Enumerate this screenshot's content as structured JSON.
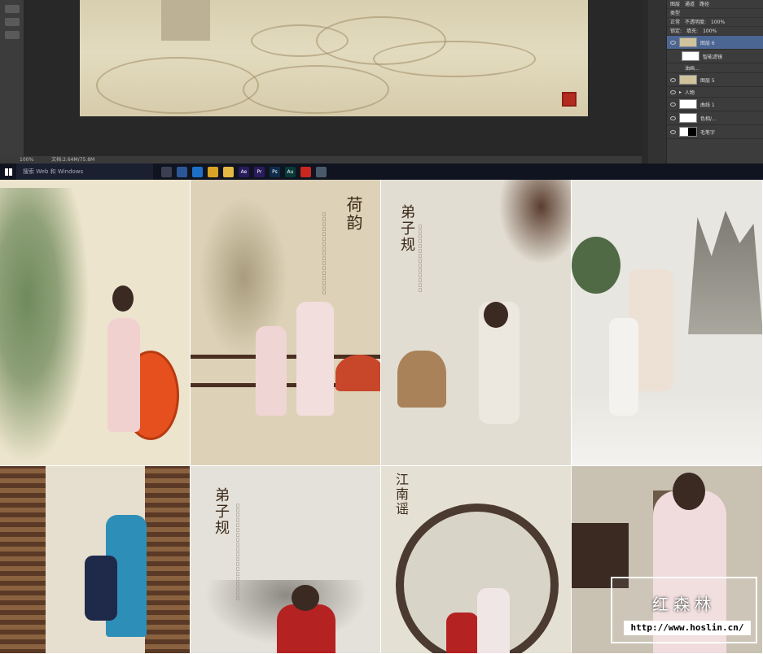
{
  "photoshop": {
    "status_zoom": "100%",
    "status_doc": "文档:2.64M/75.8M",
    "layers_panel": {
      "header_tabs": [
        "图层",
        "通道",
        "路径"
      ],
      "filter_kind": "类型",
      "blend_mode": "正常",
      "opacity_label": "不透明度:",
      "opacity_value": "100%",
      "lock_label": "锁定:",
      "fill_label": "填充:",
      "fill_value": "100%",
      "layers": [
        {
          "name": "图层 6",
          "selected": true
        },
        {
          "name": "智能滤镜",
          "selected": false
        },
        {
          "name": "油画...",
          "selected": false
        },
        {
          "name": "图层 5",
          "selected": false
        },
        {
          "name": "人物",
          "selected": false
        },
        {
          "name": "曲线 1",
          "selected": false
        },
        {
          "name": "色相/...",
          "selected": false
        },
        {
          "name": "毛笔字",
          "selected": false
        }
      ]
    }
  },
  "taskbar": {
    "search_placeholder": "搜索 Web 和 Windows",
    "apps": [
      {
        "icon": "task-view-icon",
        "color": "#3a4052"
      },
      {
        "icon": "store-icon",
        "color": "#2b5797"
      },
      {
        "icon": "edge-icon",
        "color": "#1e6fc8"
      },
      {
        "icon": "chrome-icon",
        "color": "#d9a327"
      },
      {
        "icon": "explorer-icon",
        "color": "#e3b844"
      },
      {
        "icon": "after-effects-icon",
        "color": "#2a1a5e",
        "label": "Ae"
      },
      {
        "icon": "premiere-icon",
        "color": "#2a1a5e",
        "label": "Pr"
      },
      {
        "icon": "photoshop-icon",
        "color": "#0d2c4a",
        "label": "Ps"
      },
      {
        "icon": "audition-icon",
        "color": "#083a3a",
        "label": "Au"
      },
      {
        "icon": "record-icon",
        "color": "#c8281e"
      },
      {
        "icon": "photos-icon",
        "color": "#4a5a6a"
      }
    ]
  },
  "photos": {
    "lotus_title": "荷韵",
    "dizigui_title": "弟子规",
    "jiangnan_title": "江南谣"
  },
  "watermark": {
    "name": "红森林",
    "url": "http://www.hoslin.cn/"
  }
}
